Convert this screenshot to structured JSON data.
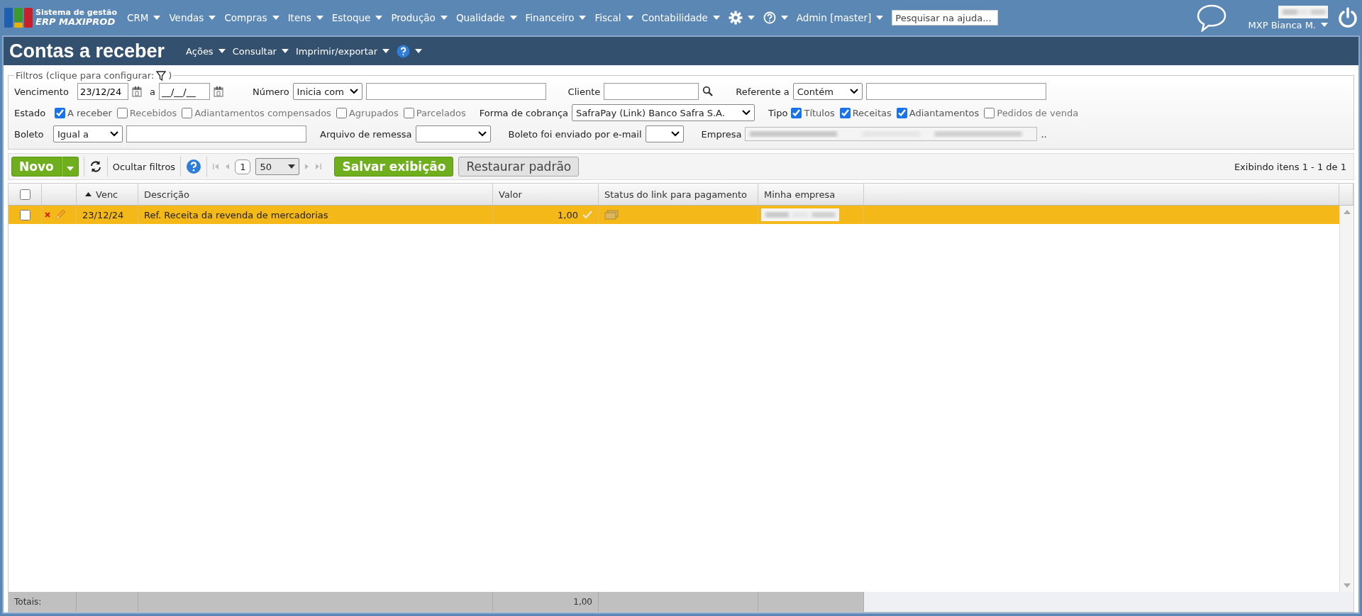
{
  "top_nav": {
    "logo": {
      "line1": "Sistema de gestão",
      "line2": "ERP MAXIPROD"
    },
    "menus": [
      "CRM",
      "Vendas",
      "Compras",
      "Itens",
      "Estoque",
      "Produção",
      "Qualidade",
      "Financeiro",
      "Fiscal",
      "Contabilidade"
    ],
    "admin": "Admin [master]",
    "search": {
      "placeholder": "Pesquisar na ajuda..."
    },
    "user": "MXP Bianca M."
  },
  "page": {
    "title": "Contas a receber",
    "actions": [
      "Ações",
      "Consultar",
      "Imprimir/exportar"
    ]
  },
  "filters": {
    "legend_start": "Filtros (clique para configurar:",
    "legend_end": ")",
    "vencimento": {
      "label": "Vencimento",
      "from": "23/12/24",
      "between": "a",
      "to": "__/__/__"
    },
    "numero": {
      "label": "Número",
      "select": "Inicia com"
    },
    "cliente": {
      "label": "Cliente"
    },
    "referente": {
      "label": "Referente a",
      "select": "Contém"
    },
    "estado": {
      "label": "Estado",
      "options": [
        {
          "label": "A receber",
          "checked": true
        },
        {
          "label": "Recebidos",
          "checked": false
        },
        {
          "label": "Adiantamentos compensados",
          "checked": false
        },
        {
          "label": "Agrupados",
          "checked": false
        },
        {
          "label": "Parcelados",
          "checked": false
        }
      ]
    },
    "forma": {
      "label": "Forma de cobrança",
      "select": "SafraPay (Link) Banco Safra S.A."
    },
    "tipo": {
      "label": "Tipo",
      "options": [
        {
          "label": "Títulos",
          "checked": true
        },
        {
          "label": "Receitas",
          "checked": true
        },
        {
          "label": "Adiantamentos",
          "checked": true
        },
        {
          "label": "Pedidos de venda",
          "checked": false
        }
      ]
    },
    "boleto": {
      "label": "Boleto",
      "select": "Igual a"
    },
    "arquivo": {
      "label": "Arquivo de remessa"
    },
    "enviado": {
      "label": "Boleto foi enviado por e-mail"
    },
    "empresa": {
      "label": "Empresa",
      "suffix": ".."
    }
  },
  "toolbar": {
    "new": "Novo",
    "hide_filters": "Ocultar filtros",
    "page": "1",
    "per_page": "50",
    "save": "Salvar exibição",
    "restore": "Restaurar padrão",
    "count": "Exibindo itens 1 - 1 de 1"
  },
  "table": {
    "all_selected": false,
    "columns": [
      {
        "label": "Venc",
        "sorted": true
      },
      {
        "label": "Descrição",
        "sorted": false
      },
      {
        "label": "Valor",
        "sorted": false
      },
      {
        "label": "Status do link para pagamento",
        "sorted": false
      },
      {
        "label": "Minha empresa",
        "sorted": false
      }
    ],
    "rows": [
      {
        "selected": false,
        "highlighted": true,
        "venc": "23/12/24",
        "descricao": "Ref. Receita da revenda de mercadorias",
        "valor": "1,00",
        "confirmed": true
      }
    ],
    "totals": {
      "label": "Totais:",
      "valor": "1,00"
    }
  }
}
